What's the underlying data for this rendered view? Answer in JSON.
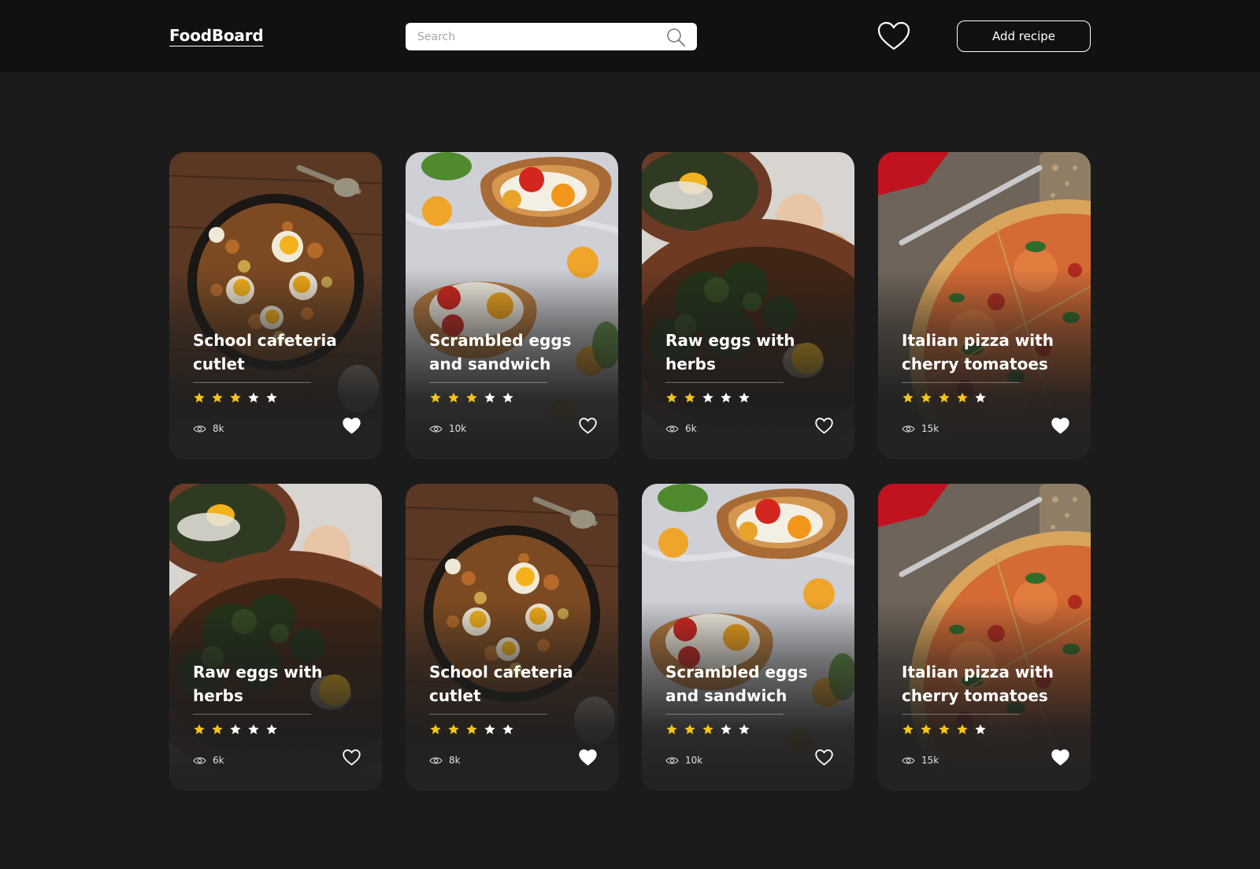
{
  "header": {
    "logo": "FoodBoard",
    "search_placeholder": "Search",
    "add_recipe_label": "Add recipe"
  },
  "colors": {
    "background": "#1b1b1b",
    "topbar": "#111111",
    "star_filled": "#f5c518",
    "star_empty": "#ffffff"
  },
  "icons": [
    "search-icon",
    "heart-icon",
    "eye-icon",
    "star-icon"
  ],
  "recipes": [
    {
      "title": "School cafeteria cutlet",
      "rating": 3,
      "views": "8k",
      "liked": true,
      "image": "skillet"
    },
    {
      "title": "Scrambled eggs and sandwich",
      "rating": 3,
      "views": "10k",
      "liked": false,
      "image": "toast"
    },
    {
      "title": "Raw eggs with herbs",
      "rating": 2,
      "views": "6k",
      "liked": false,
      "image": "bowl"
    },
    {
      "title": "Italian pizza with cherry tomatoes",
      "rating": 4,
      "views": "15k",
      "liked": true,
      "image": "pizza"
    },
    {
      "title": "Raw eggs with herbs",
      "rating": 2,
      "views": "6k",
      "liked": false,
      "image": "bowl"
    },
    {
      "title": "School cafeteria cutlet",
      "rating": 3,
      "views": "8k",
      "liked": true,
      "image": "skillet"
    },
    {
      "title": "Scrambled eggs and sandwich",
      "rating": 3,
      "views": "10k",
      "liked": false,
      "image": "toast"
    },
    {
      "title": "Italian pizza with cherry tomatoes",
      "rating": 4,
      "views": "15k",
      "liked": true,
      "image": "pizza"
    }
  ]
}
